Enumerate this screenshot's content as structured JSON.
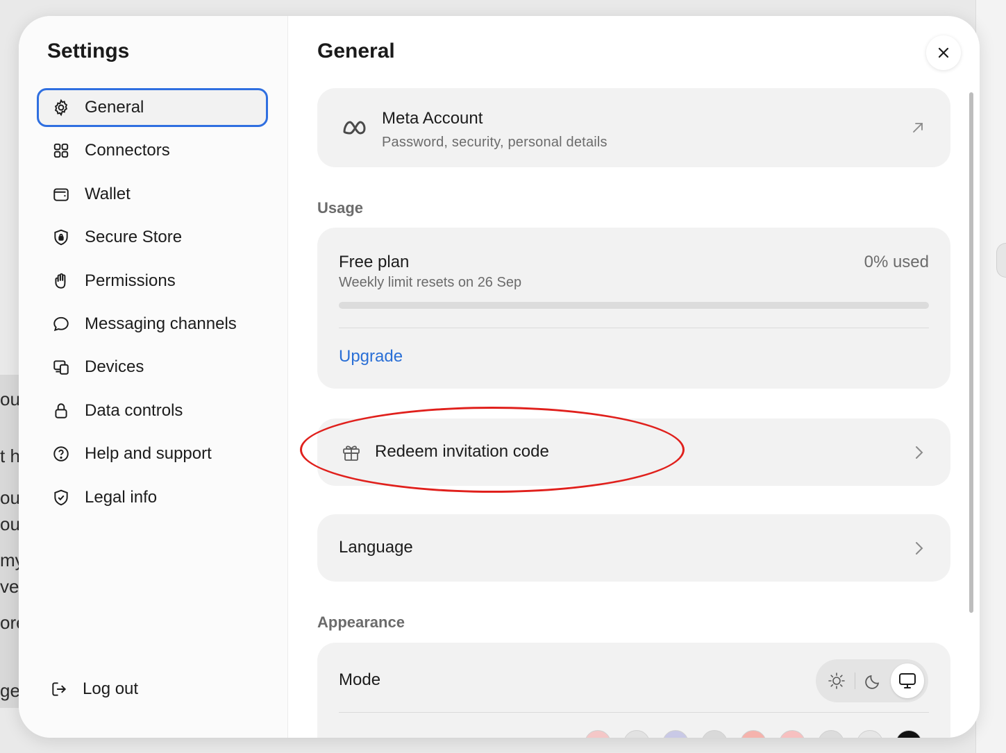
{
  "background": {
    "fragments": [
      "ou",
      "t h",
      "ou",
      "ou",
      "my",
      "ve",
      "ore",
      "ge"
    ]
  },
  "sidebar": {
    "title": "Settings",
    "items": [
      {
        "label": "General",
        "icon": "gear-icon",
        "active": true
      },
      {
        "label": "Connectors",
        "icon": "grid-icon"
      },
      {
        "label": "Wallet",
        "icon": "wallet-icon"
      },
      {
        "label": "Secure Store",
        "icon": "shield-lock-icon"
      },
      {
        "label": "Permissions",
        "icon": "hand-icon"
      },
      {
        "label": "Messaging channels",
        "icon": "chat-bubble-icon"
      },
      {
        "label": "Devices",
        "icon": "devices-icon"
      },
      {
        "label": "Data controls",
        "icon": "lock-icon"
      },
      {
        "label": "Help and support",
        "icon": "question-circle-icon"
      },
      {
        "label": "Legal info",
        "icon": "shield-check-icon"
      }
    ],
    "logout": {
      "label": "Log out",
      "icon": "logout-icon"
    }
  },
  "main": {
    "title": "General",
    "close_icon": "close-icon",
    "meta_account": {
      "title": "Meta Account",
      "subtitle": "Password, security, personal details",
      "icon": "meta-logo-icon",
      "arrow_icon": "arrow-up-right-icon"
    },
    "usage": {
      "section_label": "Usage",
      "plan": "Free plan",
      "used": "0% used",
      "used_fraction": 0,
      "reset": "Weekly limit resets on 26 Sep",
      "upgrade": "Upgrade"
    },
    "redeem": {
      "label": "Redeem invitation code",
      "icon": "gift-icon"
    },
    "language": {
      "label": "Language"
    },
    "appearance": {
      "section_label": "Appearance",
      "mode_label": "Mode",
      "modes": [
        "sun-icon",
        "moon-icon",
        "monitor-icon"
      ],
      "active_mode": "monitor-icon",
      "swatch_colors": [
        "#f4c7c7",
        "#e2e2e2",
        "#c9c9e6",
        "#d9d9d9",
        "#f5b3ad",
        "#f7c0c0",
        "#dcdcdc",
        "#e6e6e6",
        "#111111"
      ]
    }
  },
  "colors": {
    "accent": "#2f6fe0",
    "link": "#2a6fd6",
    "annotation": "#e0201c"
  }
}
